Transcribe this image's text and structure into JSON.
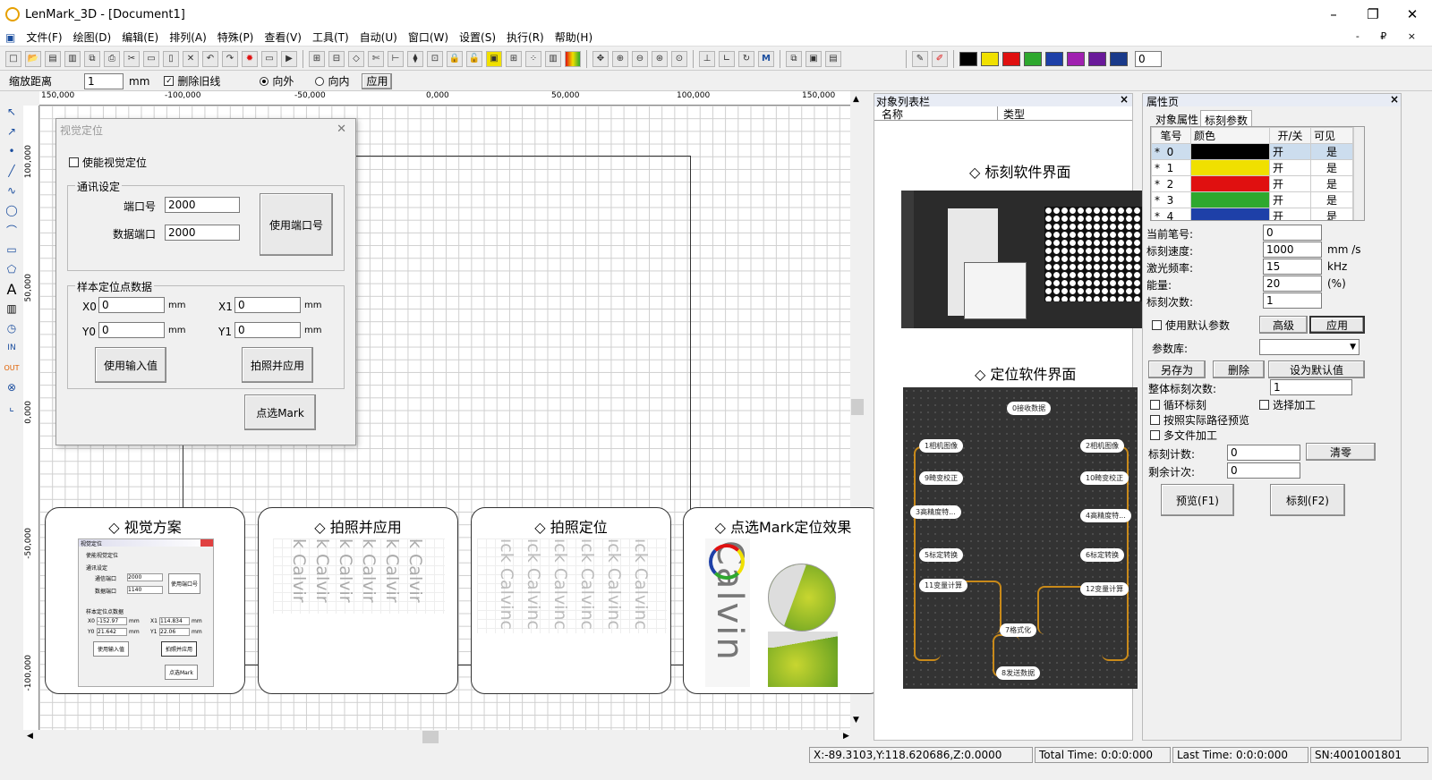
{
  "window": {
    "title": "LenMark_3D - [Document1]",
    "min": "–",
    "max": "❐",
    "close": "✕"
  },
  "menu": [
    "文件(F)",
    "绘图(D)",
    "编辑(E)",
    "排列(A)",
    "特殊(P)",
    "查看(V)",
    "工具(T)",
    "自动(U)",
    "窗口(W)",
    "设置(S)",
    "执行(R)",
    "帮助(H)"
  ],
  "mdi_controls": "- ₽ ×",
  "colors": [
    "#000000",
    "#f0e000",
    "#e01010",
    "#2ea82e",
    "#1e40a8",
    "#a020b0",
    "#6a1a9a",
    "#1a3a8a"
  ],
  "toolbar": {
    "color_index": "0",
    "m_label": "M"
  },
  "optbar": {
    "zoom_label": "缩放距离",
    "zoom_value": "1",
    "unit": "mm",
    "delete_old": "删除旧线",
    "outward": "向外",
    "inward": "向内",
    "apply": "应用"
  },
  "ruler": {
    "h": [
      "150,000",
      "-100,000",
      "-50,000",
      "0,000",
      "50,000",
      "100,000",
      "150,000"
    ],
    "v": [
      "100,000",
      "50,000",
      "0,000",
      "-50,000",
      "-100,000"
    ]
  },
  "dialog": {
    "title": "视觉定位",
    "close": "✕",
    "enable": "使能视觉定位",
    "comm_group": "通讯设定",
    "port_label": "端口号",
    "port_value": "2000",
    "data_port_label": "数据端口",
    "data_port_value": "2000",
    "use_port": "使用端口号",
    "sample_group": "样本定位点数据",
    "x0": "X0",
    "x0_value": "0",
    "y0": "Y0",
    "y0_value": "0",
    "x1": "X1",
    "x1_value": "0",
    "y1": "Y1",
    "y1_value": "0",
    "unit": "mm",
    "use_input": "使用输入值",
    "photo_apply": "拍照并应用",
    "pick_mark": "点选Mark"
  },
  "cards": [
    {
      "title": "◇ 视觉方案"
    },
    {
      "title": "◇ 拍照并应用"
    },
    {
      "title": "◇ 拍照定位"
    },
    {
      "title": "◇ 点选Mark定位效果"
    }
  ],
  "mini_dialog": {
    "title": "视觉定位",
    "enable": "使能视觉定位",
    "comm": "通讯设定",
    "port_label": "通信端口",
    "port": "2000",
    "data_label": "数据端口",
    "data": "1140",
    "use_port": "使用端口号",
    "sample": "样本定位点数据",
    "x0": "X0",
    "x0v": "-152.97",
    "y0": "Y0",
    "y0v": "21.642",
    "x1": "X1",
    "x1v": "114.834",
    "y1": "Y1",
    "y1v": "22.06",
    "unit": "mm",
    "use_input": "使用输入值",
    "photo_apply": "拍照并应用",
    "pick": "点选Mark"
  },
  "calvin": {
    "text": "Calvin",
    "text_cut": "k Calvir",
    "text_alt": "ıck Calvinc"
  },
  "object_list": {
    "title": "对象列表栏",
    "close": "×",
    "col_name": "名称",
    "col_type": "类型",
    "marking_title": "◇ 标刻软件界面",
    "locate_title": "◇ 定位软件界面"
  },
  "flow_nodes": [
    "0接收数据",
    "1相机图像",
    "2相机图像",
    "9畸变校正",
    "10畸变校正",
    "3高精度特...",
    "4高精度特...",
    "5标定转换",
    "6标定转换",
    "11变量计算",
    "12变量计算",
    "7格式化",
    "8发送数据"
  ],
  "props": {
    "title": "属性页",
    "close": "×",
    "tab1": "对象属性",
    "tab2": "标刻参数",
    "cols": [
      "笔号",
      "颜色",
      "开/关",
      "可见"
    ],
    "pens": [
      {
        "star": "*",
        "no": "0",
        "color": "#000000",
        "on": "开",
        "vis": "是"
      },
      {
        "star": "*",
        "no": "1",
        "color": "#f0e000",
        "on": "开",
        "vis": "是"
      },
      {
        "star": "*",
        "no": "2",
        "color": "#e01010",
        "on": "开",
        "vis": "是"
      },
      {
        "star": "*",
        "no": "3",
        "color": "#2ea82e",
        "on": "开",
        "vis": "是"
      },
      {
        "star": "*",
        "no": "4",
        "color": "#1e40a8",
        "on": "开",
        "vis": "是"
      }
    ],
    "cur_pen_label": "当前笔号:",
    "cur_pen": "0",
    "speed_label": "标刻速度:",
    "speed": "1000",
    "speed_unit": "mm /s",
    "freq_label": "激光频率:",
    "freq": "15",
    "freq_unit": "kHz",
    "power_label": "能量:",
    "power": "20",
    "power_unit": "(%)",
    "count_label": "标刻次数:",
    "count": "1",
    "use_default": "使用默认参数",
    "advanced": "高级",
    "apply": "应用",
    "param_lib": "参数库:",
    "save_as": "另存为",
    "delete": "删除",
    "set_default": "设为默认值",
    "total_count_label": "整体标刻次数:",
    "total_count": "1",
    "loop": "循环标刻",
    "select_proc": "选择加工",
    "preview_path": "按照实际路径预览",
    "multi_file": "多文件加工",
    "counter_label": "标刻计数:",
    "counter": "0",
    "clear": "清零",
    "remain_label": "剩余计次:",
    "remain": "0",
    "preview": "预览(F1)",
    "mark": "标刻(F2)"
  },
  "status": {
    "coords": "X:-89.3103,Y:118.620686,Z:0.0000",
    "total": "Total Time: 0:0:0:000",
    "last": "Last Time: 0:0:0:000",
    "sn": "SN:4001001801"
  }
}
